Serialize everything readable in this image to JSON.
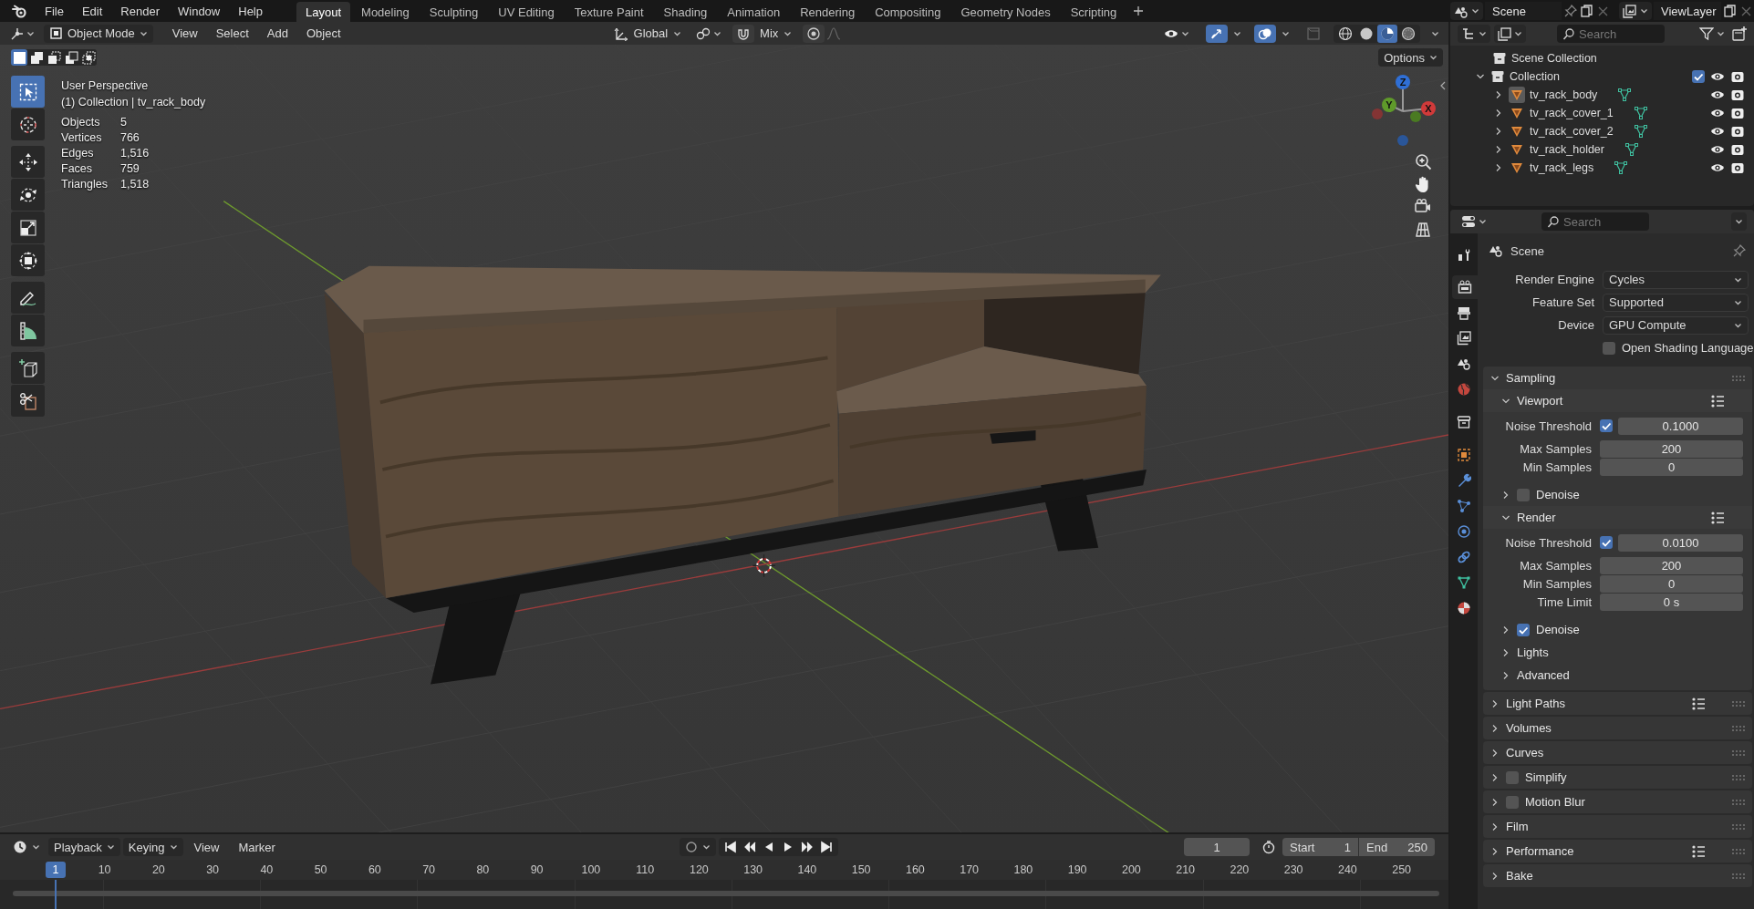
{
  "menu": [
    "File",
    "Edit",
    "Render",
    "Window",
    "Help"
  ],
  "workspaces": [
    {
      "label": "Layout",
      "selected": true
    },
    {
      "label": "Modeling",
      "selected": false
    },
    {
      "label": "Sculpting",
      "selected": false
    },
    {
      "label": "UV Editing",
      "selected": false
    },
    {
      "label": "Texture Paint",
      "selected": false
    },
    {
      "label": "Shading",
      "selected": false
    },
    {
      "label": "Animation",
      "selected": false
    },
    {
      "label": "Rendering",
      "selected": false
    },
    {
      "label": "Compositing",
      "selected": false
    },
    {
      "label": "Geometry Nodes",
      "selected": false
    },
    {
      "label": "Scripting",
      "selected": false
    }
  ],
  "scene": "Scene",
  "view_layer": "ViewLayer",
  "viewport": {
    "mode": "Object Mode",
    "menus": [
      "View",
      "Select",
      "Add",
      "Object"
    ],
    "orientation": "Global",
    "snap_target": "Mix",
    "toggles": [
      {
        "kind": "gizmo",
        "on": true
      },
      {
        "kind": "overlay",
        "on": true
      },
      {
        "kind": "xray",
        "on": false
      }
    ],
    "shading": [
      {
        "kind": "wireframe",
        "selected": false
      },
      {
        "kind": "solid",
        "selected": false
      },
      {
        "kind": "material",
        "selected": true
      },
      {
        "kind": "rendered",
        "selected": false
      }
    ],
    "select_modes": [
      {
        "kind": "set",
        "selected": true
      },
      {
        "kind": "extend",
        "selected": false
      },
      {
        "kind": "subtract",
        "selected": false
      },
      {
        "kind": "invert",
        "selected": false
      },
      {
        "kind": "intersect",
        "selected": false
      }
    ],
    "options": "Options",
    "tools": [
      {
        "kind": "select",
        "selected": true
      },
      {
        "kind": "cursor",
        "selected": false
      },
      {
        "kind": "move",
        "selected": false
      },
      {
        "kind": "rotate",
        "selected": false
      },
      {
        "kind": "scale",
        "selected": false
      },
      {
        "kind": "transform",
        "selected": false
      },
      {
        "kind": "annotate",
        "selected": false
      },
      {
        "kind": "measure",
        "selected": false
      },
      {
        "kind": "add_cube",
        "selected": false
      },
      {
        "kind": "cut",
        "selected": false
      }
    ],
    "view_name": "User Perspective",
    "context": "(1) Collection | tv_rack_body",
    "stats": [
      {
        "label": "Objects",
        "value": "5"
      },
      {
        "label": "Vertices",
        "value": "766"
      },
      {
        "label": "Edges",
        "value": "1,516"
      },
      {
        "label": "Faces",
        "value": "759"
      },
      {
        "label": "Triangles",
        "value": "1,518"
      }
    ],
    "gizmo_axes": [
      "Z",
      "Y",
      "X"
    ]
  },
  "outliner": {
    "search_placeholder": "Search",
    "tree": [
      {
        "kind": "scene_collection",
        "name": "Scene Collection",
        "children": [
          {
            "kind": "collection",
            "name": "Collection",
            "expanded": true,
            "checked": true,
            "children": [
              {
                "kind": "mesh",
                "name": "tv_rack_body",
                "expanded": false,
                "selected": true
              },
              {
                "kind": "mesh",
                "name": "tv_rack_cover_1",
                "expanded": false,
                "selected": false
              },
              {
                "kind": "mesh",
                "name": "tv_rack_cover_2",
                "expanded": false,
                "selected": false
              },
              {
                "kind": "mesh",
                "name": "tv_rack_holder",
                "expanded": false,
                "selected": false
              },
              {
                "kind": "mesh",
                "name": "tv_rack_legs",
                "expanded": false,
                "selected": false
              }
            ]
          }
        ]
      }
    ]
  },
  "properties": {
    "search_placeholder": "Search",
    "tabs": [
      {
        "kind": "tool",
        "selected": false
      },
      {
        "kind": "render",
        "selected": true
      },
      {
        "kind": "output",
        "selected": false
      },
      {
        "kind": "view_layer",
        "selected": false
      },
      {
        "kind": "scene",
        "selected": false
      },
      {
        "kind": "world",
        "selected": false
      },
      {
        "kind": "collection",
        "selected": false
      },
      {
        "kind": "object",
        "selected": false
      },
      {
        "kind": "modifiers",
        "selected": false
      },
      {
        "kind": "particles",
        "selected": false
      },
      {
        "kind": "physics",
        "selected": false
      },
      {
        "kind": "constraints",
        "selected": false
      },
      {
        "kind": "data",
        "selected": false
      },
      {
        "kind": "material",
        "selected": false
      }
    ],
    "context": "Scene",
    "rows": [
      {
        "kind": "dropdown",
        "label": "Render Engine",
        "value": "Cycles"
      },
      {
        "kind": "dropdown",
        "label": "Feature Set",
        "value": "Supported"
      },
      {
        "kind": "dropdown",
        "label": "Device",
        "value": "GPU Compute"
      },
      {
        "kind": "checkbox",
        "label": "Open Shading Language",
        "checked": false
      }
    ],
    "panels": [
      {
        "title": "Sampling",
        "expanded": true,
        "children": [
          {
            "title": "Viewport",
            "expanded": true,
            "presets": true,
            "rows": [
              {
                "kind": "threshold",
                "label": "Noise Threshold",
                "checked": true,
                "value": "0.1000"
              },
              {
                "kind": "number",
                "label": "Max Samples",
                "value": "200"
              },
              {
                "kind": "number",
                "label": "Min Samples",
                "value": "0"
              }
            ]
          },
          {
            "title": "Denoise",
            "expanded": false,
            "checked": false
          },
          {
            "title": "Render",
            "expanded": true,
            "presets": true,
            "rows": [
              {
                "kind": "threshold",
                "label": "Noise Threshold",
                "checked": true,
                "value": "0.0100"
              },
              {
                "kind": "number",
                "label": "Max Samples",
                "value": "200"
              },
              {
                "kind": "number",
                "label": "Min Samples",
                "value": "0"
              },
              {
                "kind": "number",
                "label": "Time Limit",
                "value": "0 s"
              }
            ]
          },
          {
            "title": "Denoise",
            "expanded": false,
            "checked": true
          },
          {
            "title": "Lights",
            "expanded": false
          },
          {
            "title": "Advanced",
            "expanded": false
          }
        ]
      },
      {
        "title": "Light Paths",
        "expanded": false,
        "presets": true
      },
      {
        "title": "Volumes",
        "expanded": false
      },
      {
        "title": "Curves",
        "expanded": false
      },
      {
        "title": "Simplify",
        "expanded": false,
        "checked": false
      },
      {
        "title": "Motion Blur",
        "expanded": false,
        "checked": false
      },
      {
        "title": "Film",
        "expanded": false
      },
      {
        "title": "Performance",
        "expanded": false,
        "presets": true
      },
      {
        "title": "Bake",
        "expanded": false
      }
    ]
  },
  "timeline": {
    "menus": [
      "Playback",
      "Keying",
      "View",
      "Marker"
    ],
    "auto_keying_on": false,
    "current_frame": "1",
    "start_label": "Start",
    "start": "1",
    "end_label": "End",
    "end": "250",
    "playhead": "1",
    "ruler": [
      "10",
      "20",
      "30",
      "40",
      "50",
      "60",
      "70",
      "80",
      "90",
      "100",
      "110",
      "120",
      "130",
      "140",
      "150",
      "160",
      "170",
      "180",
      "190",
      "200",
      "210",
      "220",
      "230",
      "240",
      "250"
    ]
  }
}
